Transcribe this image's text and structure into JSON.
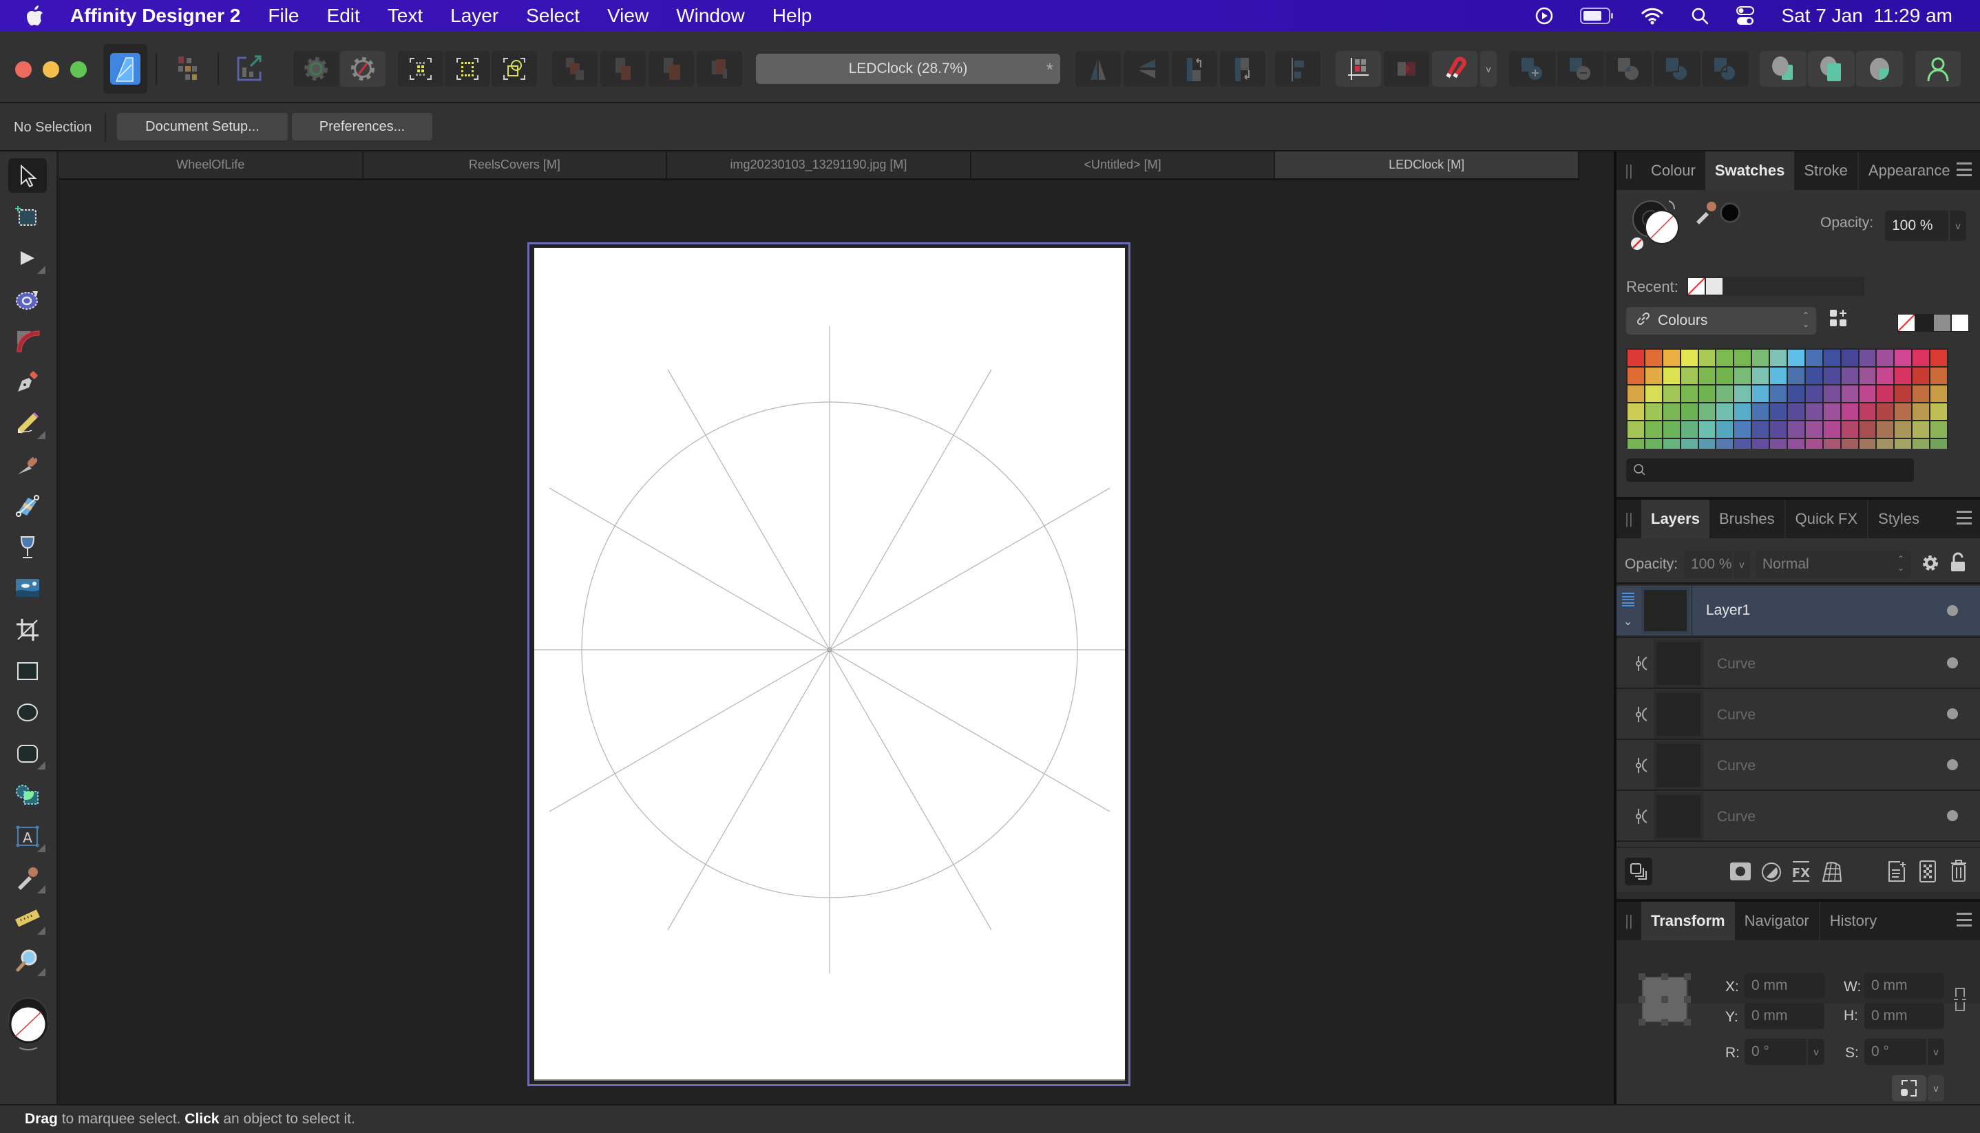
{
  "menubar": {
    "app_name": "Affinity Designer 2",
    "items": [
      "File",
      "Edit",
      "Text",
      "Layer",
      "Select",
      "View",
      "Window",
      "Help"
    ],
    "status_icons": [
      "play-circle-icon",
      "battery-icon",
      "wifi-icon",
      "search-icon",
      "control-center-icon"
    ],
    "clock": "Sat 7 Jan  11:29 am"
  },
  "toolbar": {
    "document_title": "LEDClock (28.7%)",
    "modified_marker": "*",
    "buttons": [
      "designer-persona",
      "pixel-persona",
      "export-persona",
      "view-mode",
      "snapping-options",
      "select-all",
      "select-inverse",
      "select-object",
      "move-to-back",
      "move-back-one",
      "move-forward-one",
      "move-to-front",
      "flip-horizontal",
      "flip-vertical",
      "rotate-left",
      "rotate-right",
      "align",
      "snapping-manager",
      "boolean-toggle",
      "snapping",
      "snapping-dropdown",
      "add",
      "subtract",
      "intersect",
      "xor",
      "divide",
      "insert-behind",
      "insert-inside",
      "insert-front",
      "assistant"
    ]
  },
  "context_bar": {
    "selection": "No Selection",
    "document_setup": "Document Setup...",
    "preferences": "Preferences..."
  },
  "tools": [
    "move-tool",
    "artboard-tool",
    "node-tool",
    "point-transform-tool",
    "corner-tool",
    "pen-tool",
    "pencil-tool",
    "vector-brush-tool",
    "fill-tool",
    "transparency-tool",
    "place-image-tool",
    "crop-tool",
    "rectangle-tool",
    "ellipse-tool",
    "rounded-rectangle-tool",
    "shape-builder-tool",
    "artistic-text-tool",
    "color-picker-tool",
    "measure-tool",
    "zoom-tool"
  ],
  "doc_tabs": [
    {
      "label": "WheelOfLife",
      "active": false
    },
    {
      "label": "ReelsCovers [M]",
      "active": false
    },
    {
      "label": "img20230103_13291190.jpg [M]",
      "active": false
    },
    {
      "label": "<Untitled> [M]",
      "active": false
    },
    {
      "label": "LEDClock [M]",
      "active": true
    }
  ],
  "canvas": {
    "artboard_background": "#ffffff",
    "guide_color": "#b4b4b4",
    "spoke_count": 12,
    "selection_frame_color": "#6b6bb8"
  },
  "status": {
    "drag": "Drag",
    "drag_text": " to marquee select. ",
    "click": "Click",
    "click_text": " an object to select it."
  },
  "swatches_panel": {
    "tabs": [
      {
        "label": "Colour",
        "active": false
      },
      {
        "label": "Swatches",
        "active": true
      },
      {
        "label": "Stroke",
        "active": false
      },
      {
        "label": "Appearance",
        "active": false
      }
    ],
    "opacity_label": "Opacity:",
    "opacity_value": "100 %",
    "recent_label": "Recent:",
    "palette_name": "Colours",
    "search_placeholder": "",
    "colors": [
      "#de3a35",
      "#e36b35",
      "#ebb041",
      "#e5e452",
      "#a9ca55",
      "#7dbb50",
      "#77b852",
      "#7cbb74",
      "#7ec3b6",
      "#5ec0e8",
      "#4b70b3",
      "#3f50a0",
      "#47479a",
      "#724f9d",
      "#a04f9b",
      "#cf4790",
      "#dc3361",
      "#d93b33",
      "#e06a34",
      "#e2ab42",
      "#dde251",
      "#a2c656",
      "#7eb850",
      "#72b54f",
      "#78ba78",
      "#7dc1b0",
      "#5cbbe0",
      "#4a71ae",
      "#3f4f9e",
      "#4f4a99",
      "#76509b",
      "#9c5399",
      "#c94690",
      "#d63360",
      "#c93a33",
      "#cc6a35",
      "#d9a645",
      "#d7dd55",
      "#a1c656",
      "#7bb752",
      "#70b452",
      "#73b77a",
      "#77c0b0",
      "#5bb3d9",
      "#4a73b3",
      "#3f4f9c",
      "#524a9a",
      "#784e9b",
      "#9d5299",
      "#c0468f",
      "#cd3461",
      "#bc3c3b",
      "#c26d3d",
      "#c89c45",
      "#cdcc55",
      "#9ec655",
      "#7bb654",
      "#6cb253",
      "#72b77d",
      "#71bfae",
      "#57aeca",
      "#4a73b3",
      "#43519e",
      "#584b9a",
      "#7a4f9b",
      "#9b529a",
      "#bb4491",
      "#bf3d63",
      "#b04545",
      "#b56e49",
      "#bb9a4f",
      "#bfbe55",
      "#a3c556",
      "#79b853",
      "#6bb45a",
      "#63b27f",
      "#6bbfae",
      "#55a7bf",
      "#4e7bbc",
      "#4b54a0",
      "#5a4a9b",
      "#7e4f9c",
      "#9a539b",
      "#b04894",
      "#b3466a",
      "#a5504e",
      "#a77355",
      "#ab965a",
      "#afb25c",
      "#8ab256",
      "#76b355",
      "#69b35e",
      "#67b37e",
      "#63ae9f",
      "#5a9aaf",
      "#5579b0",
      "#5258a3",
      "#644d9e",
      "#7c4f9c",
      "#934f9d",
      "#a7508f",
      "#a85770",
      "#a05e5c",
      "#a0765c",
      "#a39262",
      "#a3a462",
      "#8da95d",
      "#72a35a"
    ]
  },
  "layers_panel": {
    "tabs": [
      {
        "label": "Layers",
        "active": true
      },
      {
        "label": "Brushes",
        "active": false
      },
      {
        "label": "Quick FX",
        "active": false
      },
      {
        "label": "Styles",
        "active": false
      }
    ],
    "opacity_label": "Opacity:",
    "opacity_value": "100 %",
    "blend_mode": "Normal",
    "rows": [
      {
        "name": "Layer1",
        "type": "layer",
        "selected": true
      },
      {
        "name": "Curve",
        "type": "curve",
        "selected": false
      },
      {
        "name": "Curve",
        "type": "curve",
        "selected": false
      },
      {
        "name": "Curve",
        "type": "curve",
        "selected": false
      },
      {
        "name": "Curve",
        "type": "curve",
        "selected": false
      }
    ]
  },
  "transform_panel": {
    "tabs": [
      {
        "label": "Transform",
        "active": true
      },
      {
        "label": "Navigator",
        "active": false
      },
      {
        "label": "History",
        "active": false
      }
    ],
    "x_label": "X:",
    "x_value": "0 mm",
    "y_label": "Y:",
    "y_value": "0 mm",
    "w_label": "W:",
    "w_value": "0 mm",
    "h_label": "H:",
    "h_value": "0 mm",
    "r_label": "R:",
    "r_value": "0 °",
    "s_label": "S:",
    "s_value": "0 °"
  }
}
